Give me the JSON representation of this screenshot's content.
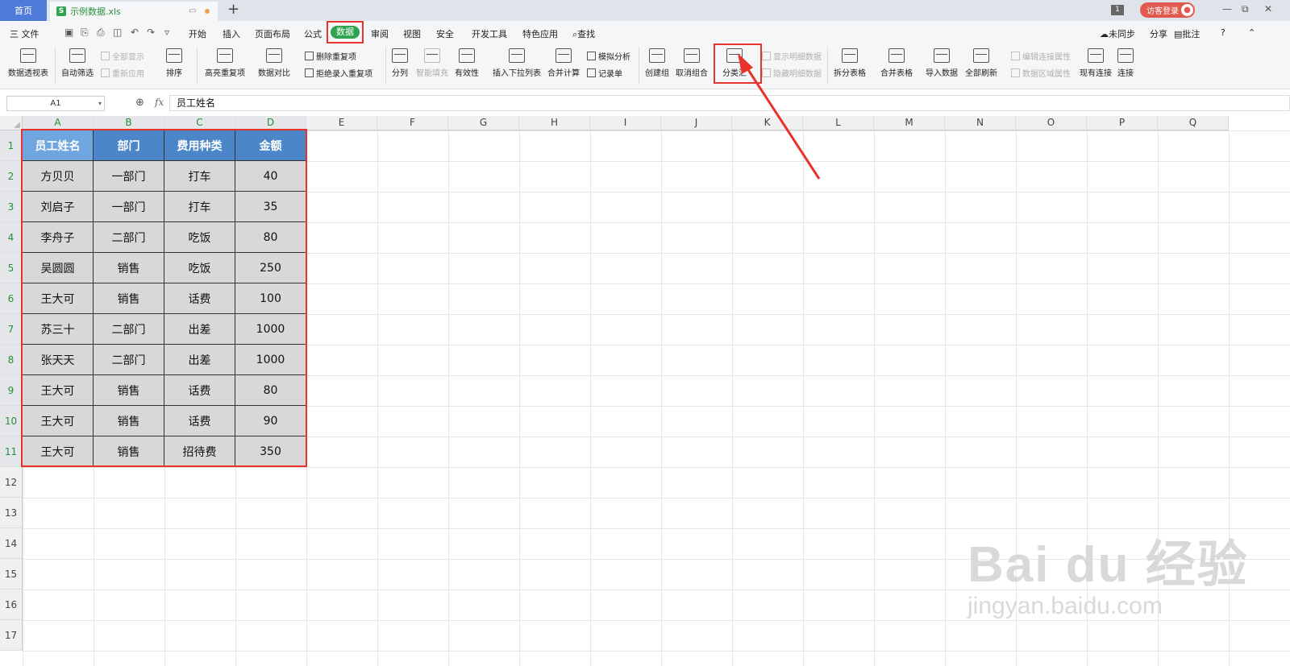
{
  "titlebar": {
    "home_tab": "首页",
    "file_logo": "S",
    "file_tab": "示例数据.xls",
    "new_tab": "+",
    "badge": "1",
    "login": "访客登录",
    "controls": [
      "—",
      "⧉",
      "✕"
    ]
  },
  "menu": {
    "file": "三 文件",
    "items": [
      "开始",
      "插入",
      "页面布局",
      "公式",
      "数据",
      "审阅",
      "视图",
      "安全",
      "开发工具",
      "特色应用"
    ],
    "search": "查找",
    "right": [
      "未同步",
      "分享",
      "批注",
      "?"
    ]
  },
  "ribbon": {
    "pivot": "数据透视表",
    "autofilter": "自动筛选",
    "show_all": "全部显示",
    "reapply": "重新应用",
    "sort": "排序",
    "highlight_dup": "高亮重复项",
    "data_compare": "数据对比",
    "remove_dup": "删除重复项",
    "reject_dup": "拒绝录入重复项",
    "split": "分列",
    "smart_fill": "智能填充",
    "validity": "有效性",
    "insert_dropdown": "插入下拉列表",
    "consolidate": "合并计算",
    "whatif": "模拟分析",
    "record": "记录单",
    "group": "创建组",
    "ungroup": "取消组合",
    "subtotal": "分类汇",
    "show_detail": "显示明细数据",
    "hide_detail": "隐藏明细数据",
    "split_table": "拆分表格",
    "merge_table": "合并表格",
    "import_data": "导入数据",
    "refresh_all": "全部刷新",
    "edit_conn": "编辑连接属性",
    "range_prop": "数据区域属性",
    "existing_conn": "现有连接",
    "connect": "连接"
  },
  "formula_bar": {
    "name_box": "A1",
    "fx": "fx",
    "content": "员工姓名"
  },
  "grid": {
    "columns": [
      "A",
      "B",
      "C",
      "D",
      "E",
      "F",
      "G",
      "H",
      "I",
      "J",
      "K",
      "L",
      "M",
      "N",
      "O",
      "P",
      "Q"
    ],
    "rows": [
      "1",
      "2",
      "3",
      "4",
      "5",
      "6",
      "7",
      "8",
      "9",
      "10",
      "11",
      "12",
      "13",
      "14",
      "15",
      "16",
      "17"
    ]
  },
  "table": {
    "headers": [
      "员工姓名",
      "部门",
      "费用种类",
      "金额"
    ],
    "rows": [
      [
        "方贝贝",
        "一部门",
        "打车",
        "40"
      ],
      [
        "刘启子",
        "一部门",
        "打车",
        "35"
      ],
      [
        "李舟子",
        "二部门",
        "吃饭",
        "80"
      ],
      [
        "吴圆圆",
        "销售",
        "吃饭",
        "250"
      ],
      [
        "王大可",
        "销售",
        "话费",
        "100"
      ],
      [
        "苏三十",
        "二部门",
        "出差",
        "1000"
      ],
      [
        "张天天",
        "二部门",
        "出差",
        "1000"
      ],
      [
        "王大可",
        "销售",
        "话费",
        "80"
      ],
      [
        "王大可",
        "销售",
        "话费",
        "90"
      ],
      [
        "王大可",
        "销售",
        "招待费",
        "350"
      ]
    ]
  },
  "watermark": {
    "brand": "Bai du 经验",
    "url": "jingyan.baidu.com"
  },
  "colors": {
    "accent_green": "#2ea44f",
    "highlight_red": "#e8332a",
    "header_blue": "#4a86c8"
  }
}
